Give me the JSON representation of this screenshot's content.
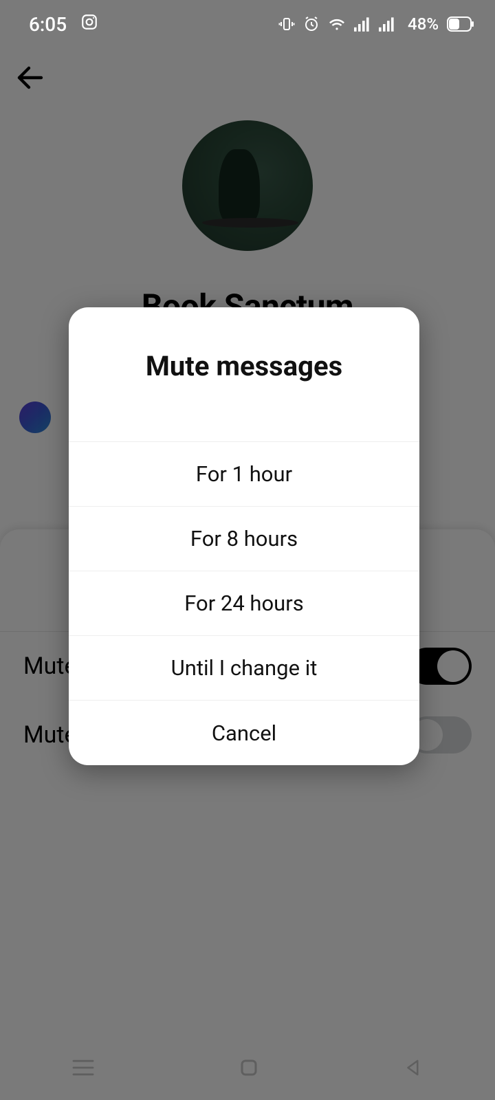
{
  "statusbar": {
    "time": "6:05",
    "battery_percent": "48%"
  },
  "profile": {
    "name": "Book Sanctum"
  },
  "settings": {
    "mute_messages_label": "Mute messages",
    "mute_calls_label": "Mute calls"
  },
  "dialog": {
    "title": "Mute messages",
    "options": {
      "hour1": "For 1 hour",
      "hour8": "For 8 hours",
      "hour24": "For 24 hours",
      "until": "Until I change it",
      "cancel": "Cancel"
    }
  }
}
